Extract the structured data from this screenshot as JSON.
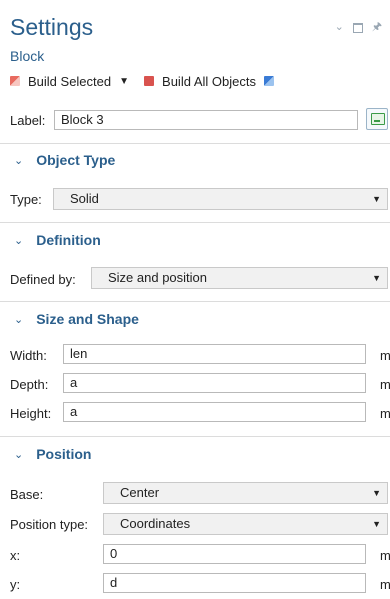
{
  "header": {
    "title": "Settings",
    "subtitle": "Block"
  },
  "toolbar": {
    "build_selected_label": "Build Selected",
    "build_all_label": "Build All Objects"
  },
  "label_row": {
    "label": "Label:",
    "value": "Block 3"
  },
  "sections": {
    "object_type": {
      "title": "Object Type",
      "type_label": "Type:",
      "type_value": "Solid"
    },
    "definition": {
      "title": "Definition",
      "defined_by_label": "Defined by:",
      "defined_by_value": "Size and position"
    },
    "size_shape": {
      "title": "Size and Shape",
      "width_label": "Width:",
      "width_value": "len",
      "depth_label": "Depth:",
      "depth_value": "a",
      "height_label": "Height:",
      "height_value": "a",
      "unit": "m"
    },
    "position": {
      "title": "Position",
      "base_label": "Base:",
      "base_value": "Center",
      "position_type_label": "Position type:",
      "position_type_value": "Coordinates",
      "x_label": "x:",
      "x_value": "0",
      "y_label": "y:",
      "y_value": "d",
      "unit": "m"
    }
  },
  "colors": {
    "accent": "#2b5f8c",
    "build_selected_icon": "#d9534f",
    "build_all_icon": "#d9534f",
    "extra_icon": "#3a7bd5"
  }
}
